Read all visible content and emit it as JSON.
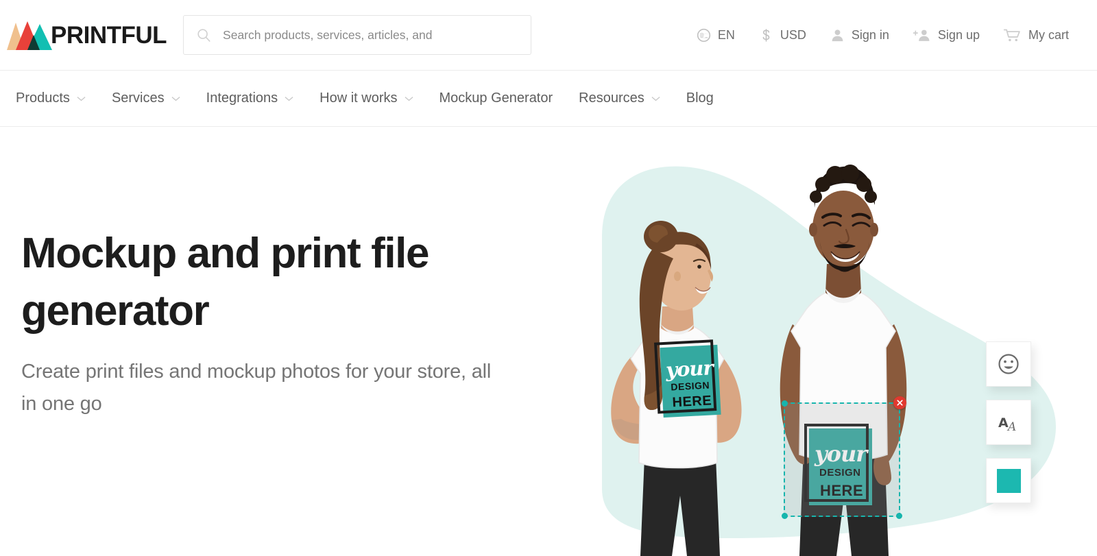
{
  "brand": {
    "name": "PRINTFUL",
    "logo_colors": [
      "#f0c08d",
      "#e8413a",
      "#12bfb2",
      "#0f3b33"
    ]
  },
  "header": {
    "search": {
      "placeholder": "Search products, services, articles, and",
      "value": "",
      "icon": "search-icon"
    },
    "utility_items": [
      {
        "label": "EN",
        "icon": "globe-icon"
      },
      {
        "label": "USD",
        "icon": "dollar-icon"
      },
      {
        "label": "Sign in",
        "icon": "user-icon"
      },
      {
        "label": "Sign up",
        "icon": "user-plus-icon"
      },
      {
        "label": "My cart",
        "icon": "cart-icon"
      }
    ]
  },
  "main_nav": {
    "items": [
      {
        "label": "Products",
        "has_dropdown": true
      },
      {
        "label": "Services",
        "has_dropdown": true
      },
      {
        "label": "Integrations",
        "has_dropdown": true
      },
      {
        "label": "How it works",
        "has_dropdown": true
      },
      {
        "label": "Mockup Generator",
        "has_dropdown": false
      },
      {
        "label": "Resources",
        "has_dropdown": true
      },
      {
        "label": "Blog",
        "has_dropdown": false
      }
    ]
  },
  "hero": {
    "title": "Mockup and print file generator",
    "subtitle": "Create print files and mockup photos for your store, all in one go",
    "artwork": {
      "design_script_text": "your",
      "design_line2": "DESIGN",
      "design_line3": "HERE",
      "design_color": "#34a9a0",
      "backdrop_color": "#dff2ef",
      "selection": {
        "accent_color": "#17b5ad",
        "close_color": "#e0392f",
        "close_icon": "close-icon"
      }
    },
    "tools": [
      {
        "name": "clipart-tool",
        "icon": "smiley-icon"
      },
      {
        "name": "text-tool",
        "icon": "text-aa-icon"
      },
      {
        "name": "color-tool",
        "icon": "color-swatch-icon",
        "color": "#1cb8b0"
      }
    ]
  }
}
